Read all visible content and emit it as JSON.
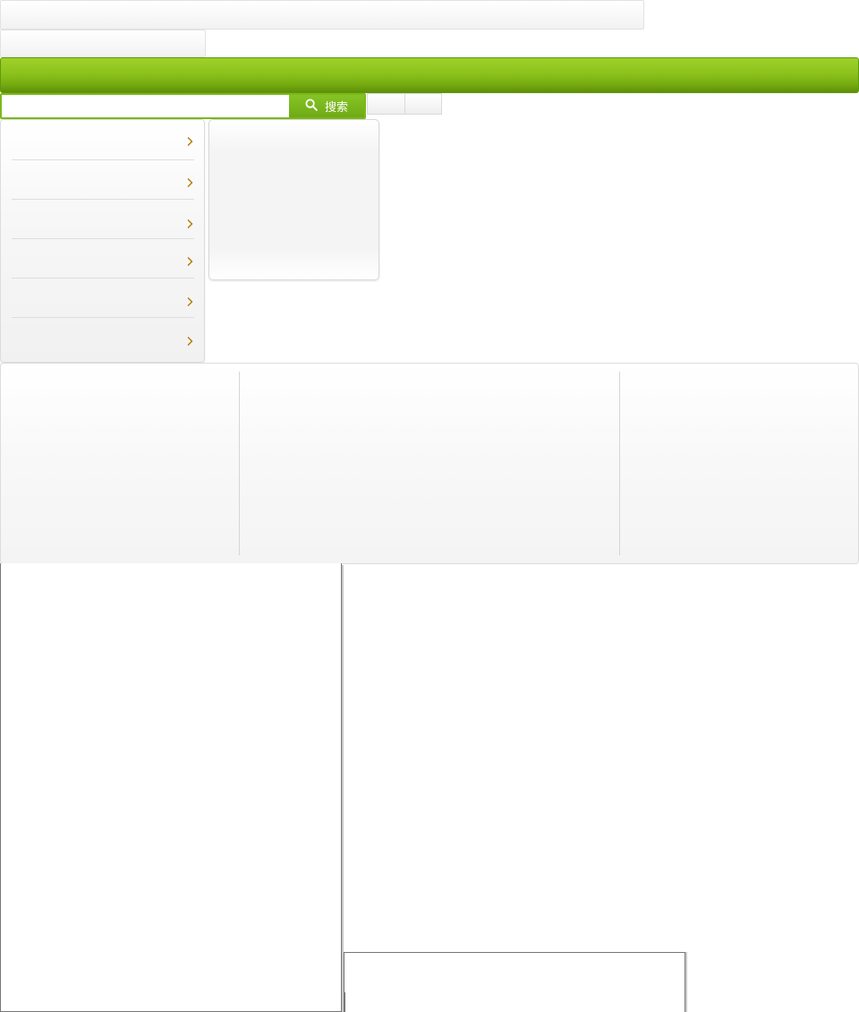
{
  "header": {
    "top_bar_text": "",
    "sub_bar_text": ""
  },
  "nav": {
    "background_colors": [
      "#9ed12a",
      "#5e8f08"
    ]
  },
  "search": {
    "input_value": "",
    "placeholder": "",
    "button_label": "搜索",
    "button_icon": "search-icon",
    "accent_color": "#7cb919"
  },
  "tabs": [
    {
      "label": ""
    },
    {
      "label": ""
    }
  ],
  "category_menu": {
    "items": [
      {
        "label": "",
        "icon": "chevron-right-icon"
      },
      {
        "label": "",
        "icon": "chevron-right-icon"
      },
      {
        "label": "",
        "icon": "chevron-right-icon"
      },
      {
        "label": "",
        "icon": "chevron-right-icon"
      },
      {
        "label": "",
        "icon": "chevron-right-icon"
      },
      {
        "label": "",
        "icon": "chevron-right-icon"
      }
    ],
    "chevron_color": "#b07a00"
  }
}
